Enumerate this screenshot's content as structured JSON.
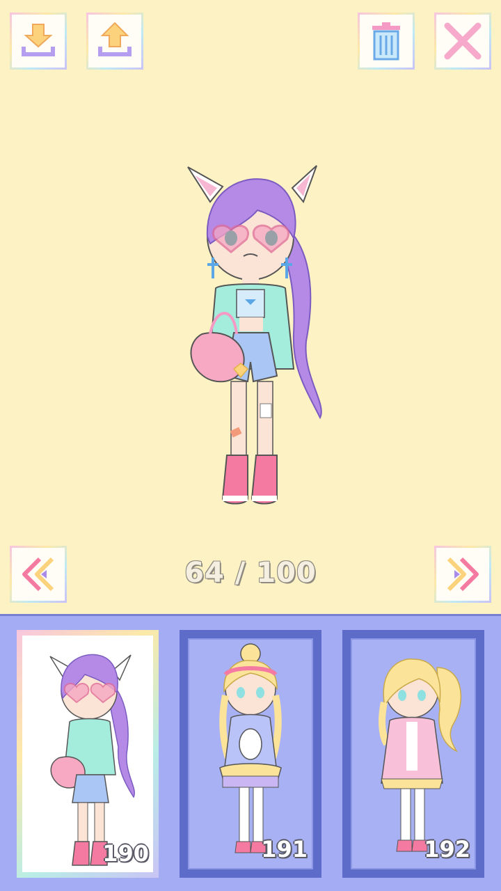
{
  "toolbar": {
    "icons": [
      "download-icon",
      "upload-icon",
      "trash-icon",
      "close-icon"
    ]
  },
  "navigation": {
    "counter": "64 / 100",
    "prev_icon": "double-chevron-left-icon",
    "next_icon": "double-chevron-right-icon"
  },
  "gallery": {
    "slots": [
      {
        "number": "190",
        "selected": true
      },
      {
        "number": "191",
        "selected": false
      },
      {
        "number": "192",
        "selected": false
      }
    ]
  },
  "colors": {
    "background": "#fdf2c3",
    "tray": "#a4acf3",
    "slot_frame": "#5d6cc8",
    "accent_purple": "#a98be9",
    "accent_pink": "#f49ac4"
  }
}
